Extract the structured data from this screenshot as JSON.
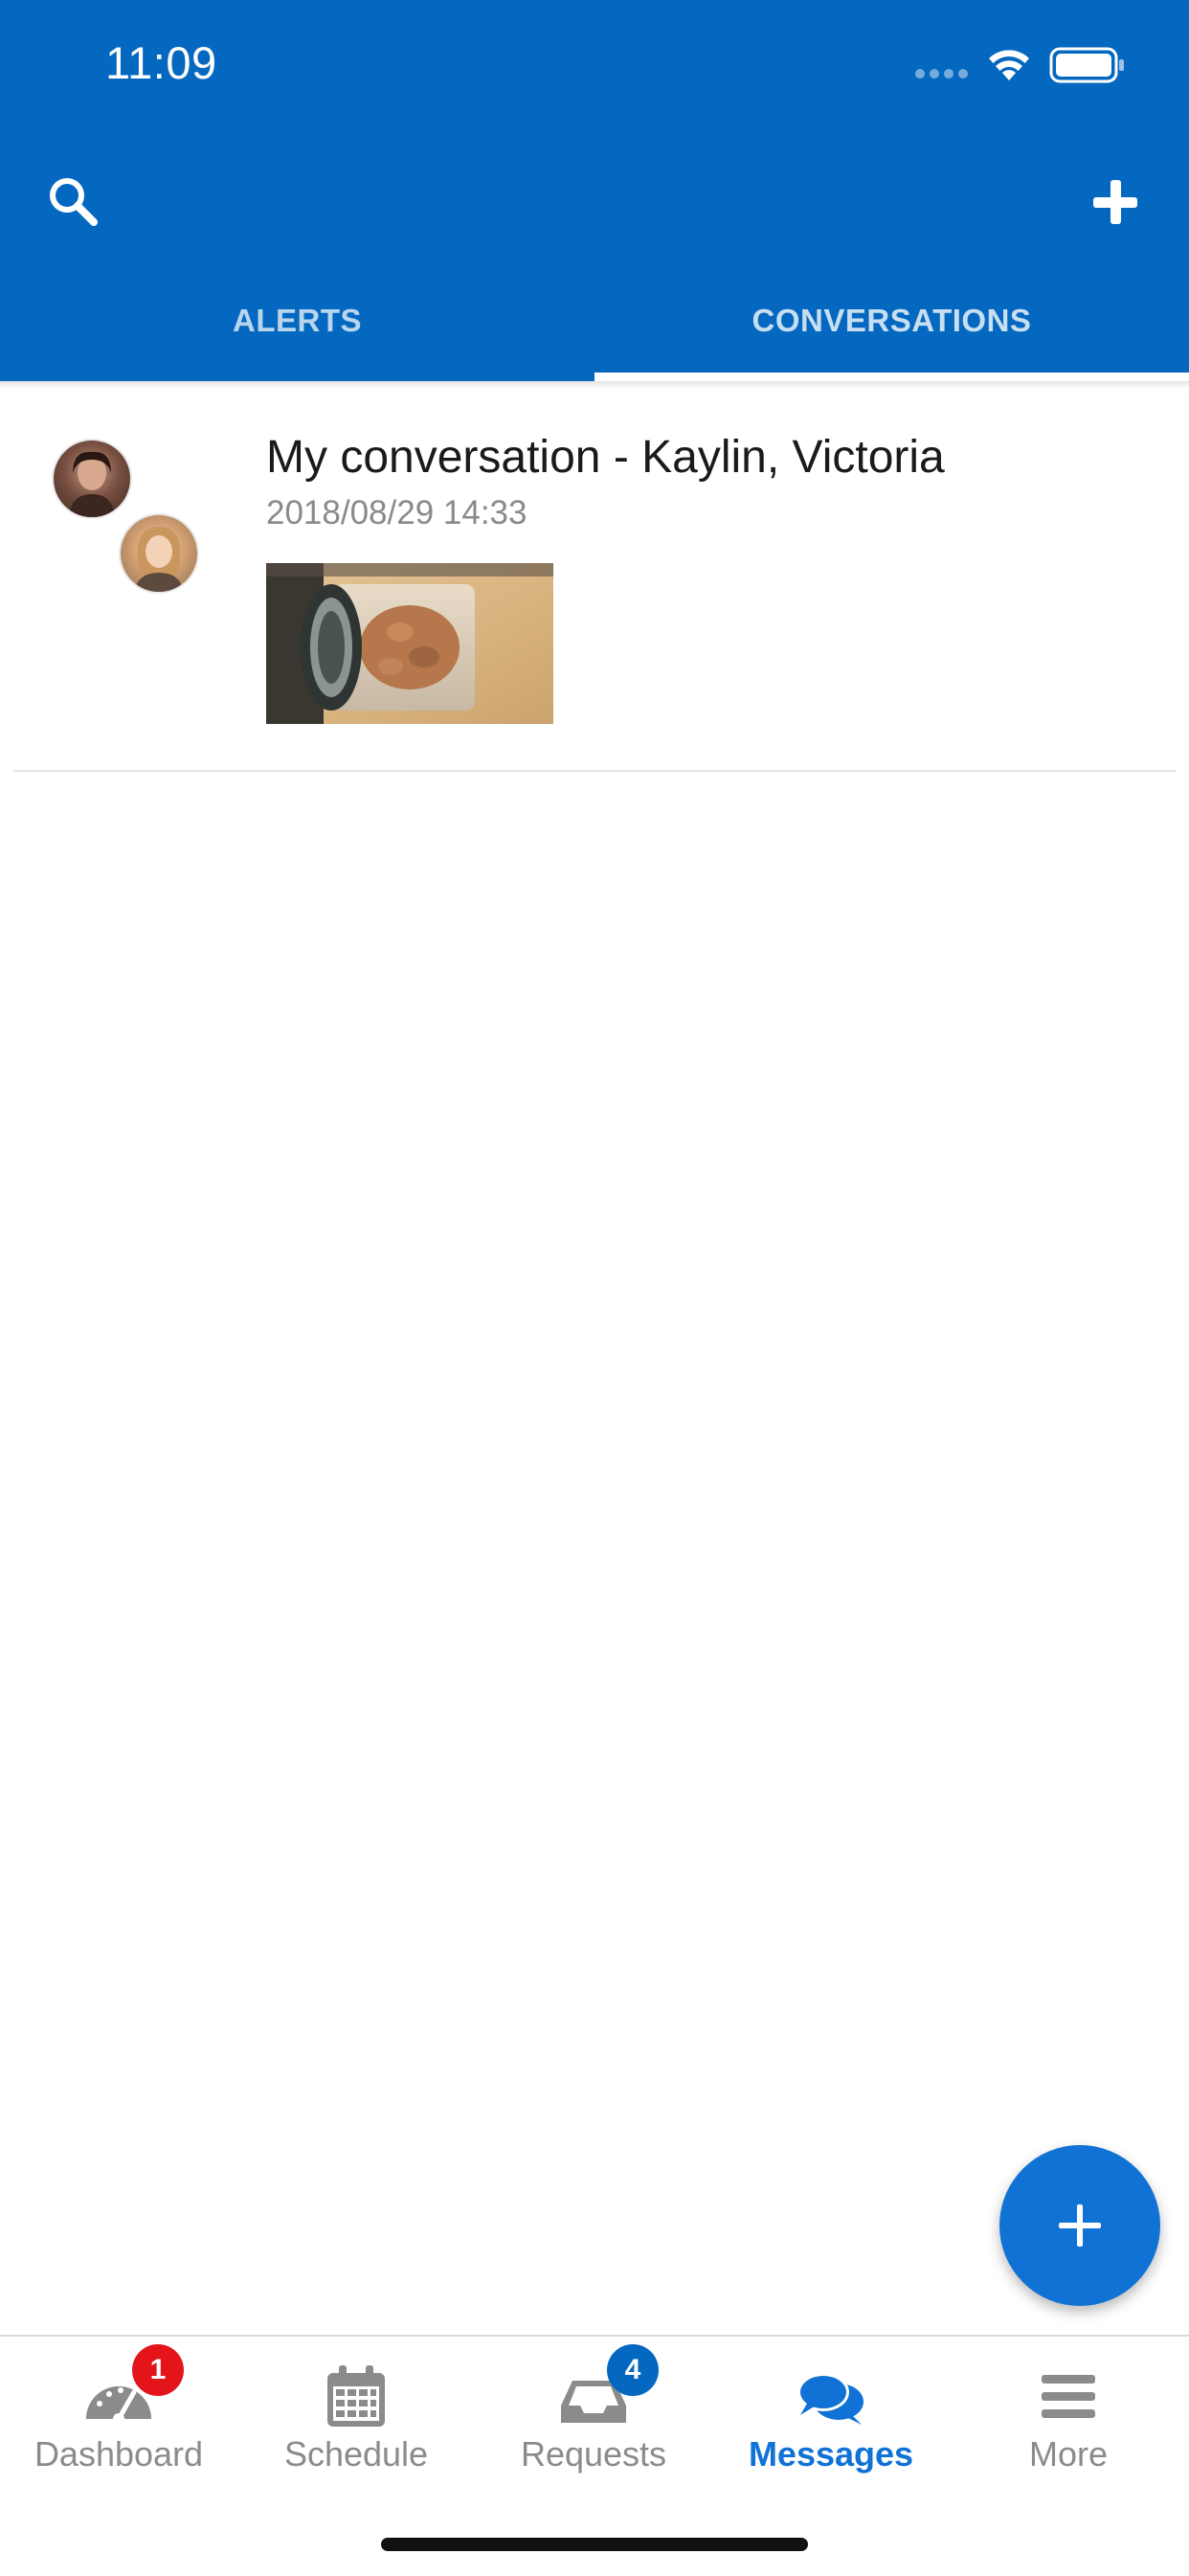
{
  "status_bar": {
    "time": "11:09"
  },
  "header": {
    "tabs": [
      {
        "label": "ALERTS",
        "active": false
      },
      {
        "label": "CONVERSATIONS",
        "active": true
      }
    ],
    "accent_color": "#0568C0"
  },
  "conversations": [
    {
      "title": "My conversation - Kaylin, Victoria",
      "date": "2018/08/29  14:33",
      "participants": [
        "avatar-kaylin",
        "avatar-victoria"
      ],
      "thumbnail": "jar-photo"
    }
  ],
  "fab": {
    "icon": "plus-icon"
  },
  "bottom_nav": {
    "items": [
      {
        "label": "Dashboard",
        "icon": "gauge-icon",
        "badge": "1",
        "active": false
      },
      {
        "label": "Schedule",
        "icon": "calendar-icon",
        "badge": null,
        "active": false
      },
      {
        "label": "Requests",
        "icon": "inbox-icon",
        "badge": "4",
        "active": false
      },
      {
        "label": "Messages",
        "icon": "chat-bubbles-icon",
        "badge": null,
        "active": true
      },
      {
        "label": "More",
        "icon": "menu-icon",
        "badge": null,
        "active": false
      }
    ],
    "active_color": "#0F72D4",
    "inactive_color": "#8b8b8b"
  }
}
